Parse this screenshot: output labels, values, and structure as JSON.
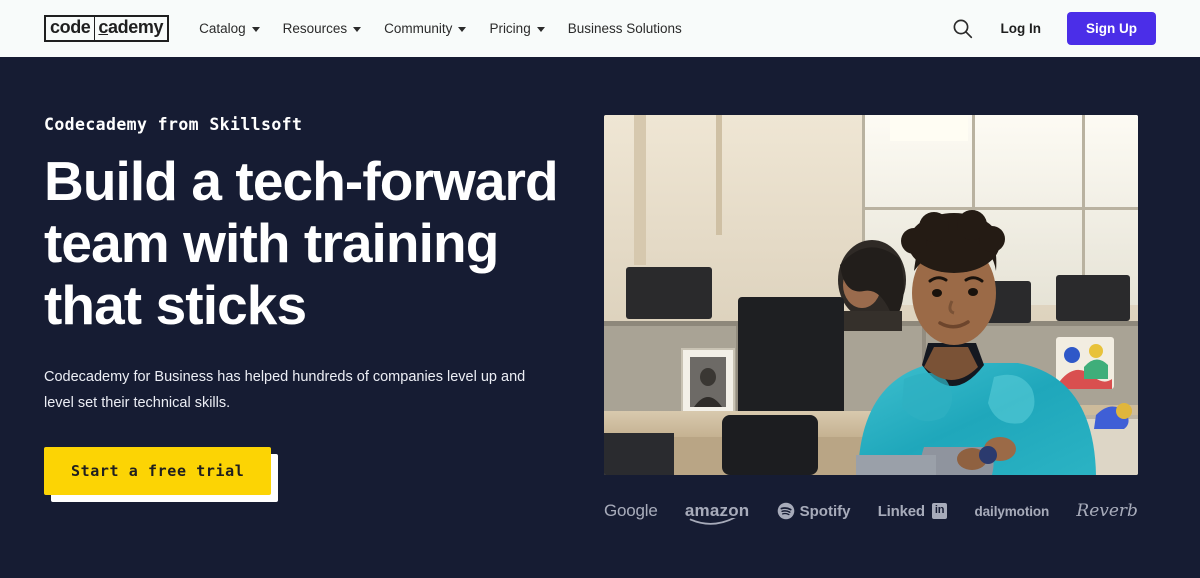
{
  "header": {
    "logo": {
      "boxed": "code",
      "rest_first": "c",
      "rest_tail": "ademy",
      "name": "codecademy"
    },
    "nav": [
      {
        "label": "Catalog",
        "has_dropdown": true
      },
      {
        "label": "Resources",
        "has_dropdown": true
      },
      {
        "label": "Community",
        "has_dropdown": true
      },
      {
        "label": "Pricing",
        "has_dropdown": true
      },
      {
        "label": "Business Solutions",
        "has_dropdown": false
      }
    ],
    "search_icon": "search-icon",
    "login_label": "Log In",
    "signup_label": "Sign Up",
    "signup_color": "#4b2ee8",
    "background": "#f8fbfa"
  },
  "hero": {
    "eyebrow": "Codecademy from Skillsoft",
    "headline_lines": [
      "Build a tech-forward",
      "team with training",
      "that sticks"
    ],
    "subcopy": "Codecademy for Business has helped hundreds of companies level up and level set their technical skills.",
    "cta_label": "Start a free trial",
    "cta_color": "#fcd404",
    "background": "#161c33",
    "image_alt": "Person in teal hoodie seated in an open-plan office with desks and monitors"
  },
  "brands": {
    "heading": "",
    "items": [
      {
        "name": "Google",
        "label": "Google"
      },
      {
        "name": "amazon",
        "label": "amazon"
      },
      {
        "name": "Spotify",
        "label": "Spotify"
      },
      {
        "name": "LinkedIn",
        "label": "Linked",
        "suffix": "in"
      },
      {
        "name": "dailymotion",
        "label": "dailymotion"
      },
      {
        "name": "Reverb",
        "label": "Reverb"
      }
    ]
  }
}
